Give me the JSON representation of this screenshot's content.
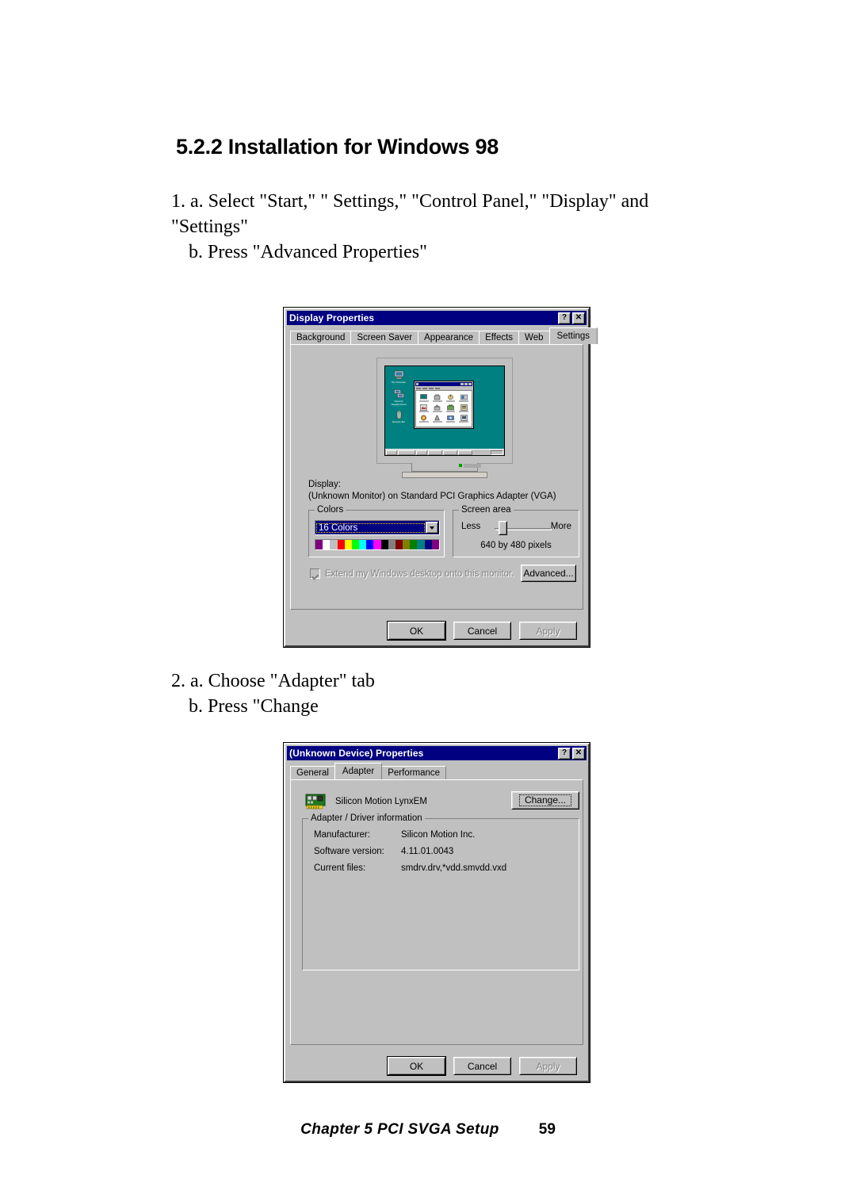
{
  "document": {
    "heading": "5.2.2 Installation for Windows 98",
    "step1": {
      "line_a": "1. a. Select \"Start,\" \" Settings,\" \"Control Panel,\" \"Display\" and \"Settings\"",
      "line_b": "b. Press \"Advanced Properties\""
    },
    "step2": {
      "line_a": "2. a. Choose \"Adapter\" tab",
      "line_b": "b. Press \"Change"
    },
    "footer": {
      "chapter": "Chapter 5  PCI SVGA Setup",
      "page_number": "59"
    }
  },
  "display_properties": {
    "title": "Display Properties",
    "help_button": "?",
    "close_button": "✕",
    "tabs": [
      {
        "label": "Background",
        "selected": false
      },
      {
        "label": "Screen Saver",
        "selected": false
      },
      {
        "label": "Appearance",
        "selected": false
      },
      {
        "label": "Effects",
        "selected": false
      },
      {
        "label": "Web",
        "selected": false
      },
      {
        "label": "Settings",
        "selected": true
      }
    ],
    "display_label": "Display:",
    "display_value": "(Unknown Monitor) on Standard PCI Graphics Adapter (VGA)",
    "colors_group": {
      "label": "Colors",
      "selected": "16 Colors",
      "palette": [
        "#800080",
        "#ffffff",
        "#c0c0c0",
        "#ff0000",
        "#ffff00",
        "#00ff00",
        "#00ffff",
        "#0000ff",
        "#ff00ff",
        "#000000",
        "#808080",
        "#800000",
        "#808000",
        "#008000",
        "#008080",
        "#000080",
        "#800080"
      ]
    },
    "screen_area_group": {
      "label": "Screen area",
      "less": "Less",
      "more": "More",
      "resolution": "640 by 480 pixels",
      "slider_percent": 8
    },
    "extend_checkbox": {
      "label": "Extend my Windows desktop onto this monitor.",
      "checked": true,
      "enabled": false
    },
    "advanced_button": "Advanced...",
    "buttons": [
      {
        "label": "OK",
        "default": true,
        "enabled": true
      },
      {
        "label": "Cancel",
        "default": false,
        "enabled": true
      },
      {
        "label": "Apply",
        "default": false,
        "enabled": false
      }
    ],
    "monitor_preview": {
      "desktop_color": "#008080",
      "desktop_icons": [
        {
          "name": "My Computer",
          "caption": "My Computer"
        },
        {
          "name": "Network Neighborhood",
          "caption": "Network Neighborhood"
        },
        {
          "name": "Recycle Bin",
          "caption": "Recycle Bin"
        }
      ],
      "window_title": "Control Panel",
      "icon_count": 12
    }
  },
  "adapter_properties": {
    "title": "(Unknown Device) Properties",
    "help_button": "?",
    "close_button": "✕",
    "tabs": [
      {
        "label": "General",
        "selected": false
      },
      {
        "label": "Adapter",
        "selected": true
      },
      {
        "label": "Performance",
        "selected": false
      }
    ],
    "adapter_name": "Silicon Motion LynxEM",
    "change_button": "Change...",
    "info_group": {
      "label": "Adapter / Driver information",
      "rows": [
        {
          "label": "Manufacturer:",
          "value": "Silicon Motion Inc."
        },
        {
          "label": "Software version:",
          "value": "4.11.01.0043"
        },
        {
          "label": "Current files:",
          "value": "smdrv.drv,*vdd.smvdd.vxd"
        }
      ]
    },
    "buttons": [
      {
        "label": "OK",
        "default": true,
        "enabled": true
      },
      {
        "label": "Cancel",
        "default": false,
        "enabled": true
      },
      {
        "label": "Apply",
        "default": false,
        "enabled": false
      }
    ]
  },
  "colors": {
    "titlebar": "#000080",
    "dialog_face": "#c0c0c0",
    "desktop": "#008080"
  }
}
